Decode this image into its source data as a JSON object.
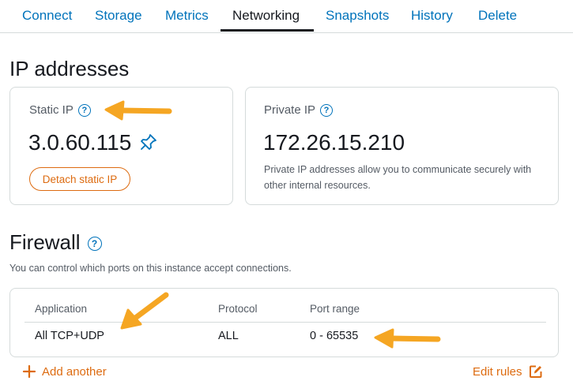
{
  "tabs": [
    {
      "label": "Connect"
    },
    {
      "label": "Storage"
    },
    {
      "label": "Metrics"
    },
    {
      "label": "Networking",
      "active": true
    },
    {
      "label": "Snapshots"
    },
    {
      "label": "History"
    },
    {
      "label": "Delete"
    }
  ],
  "ip_section": {
    "title": "IP addresses",
    "static_ip": {
      "label": "Static IP",
      "value": "3.0.60.115",
      "detach_label": "Detach static IP"
    },
    "private_ip": {
      "label": "Private IP",
      "value": "172.26.15.210",
      "description": "Private IP addresses allow you to communicate securely with other internal resources."
    }
  },
  "firewall": {
    "title": "Firewall",
    "subtitle": "You can control which ports on this instance accept connections.",
    "columns": [
      "Application",
      "Protocol",
      "Port range"
    ],
    "rows": [
      {
        "application": "All TCP+UDP",
        "protocol": "ALL",
        "port_range": "0 - 65535"
      }
    ],
    "add_label": "Add another",
    "edit_label": "Edit rules"
  },
  "colors": {
    "link": "#0073bb",
    "accent": "#dd6b10",
    "annotation_arrow": "#f5a623",
    "text": "#16191f",
    "muted": "#545b64"
  },
  "icons": [
    "help-icon",
    "pin-icon",
    "plus-icon",
    "edit-icon",
    "annotation-arrow"
  ]
}
